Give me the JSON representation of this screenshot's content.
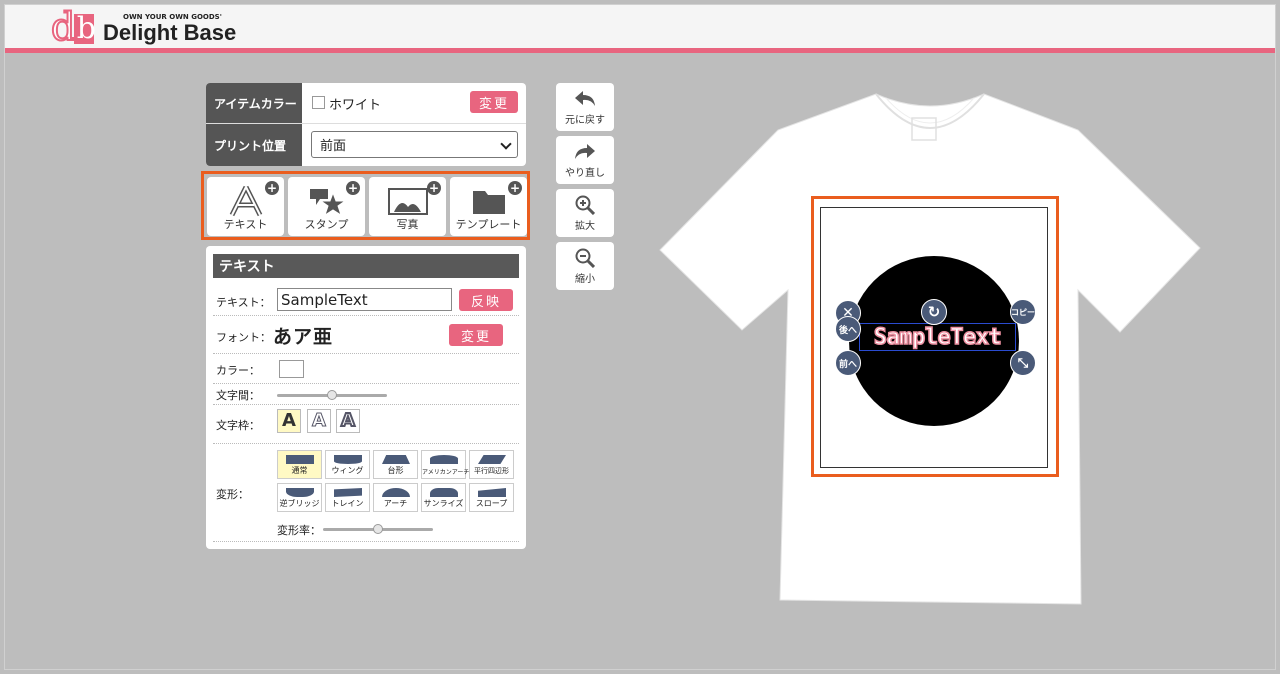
{
  "header": {
    "brand_tagline": "OWN YOUR OWN GOODS'",
    "brand_name": "Delight Base",
    "logo_mark": "db"
  },
  "options": {
    "item_color_label": "アイテムカラー",
    "item_color_value": "ホワイト",
    "item_color_change": "変更",
    "print_position_label": "プリント位置",
    "print_position_value": "前面"
  },
  "tools": [
    {
      "label": "テキスト",
      "icon": "text-a-icon"
    },
    {
      "label": "スタンプ",
      "icon": "stamp-star-icon"
    },
    {
      "label": "写真",
      "icon": "photo-icon"
    },
    {
      "label": "テンプレート",
      "icon": "folder-icon"
    }
  ],
  "side": {
    "undo": "元に戻す",
    "redo": "やり直し",
    "zoom_in": "拡大",
    "zoom_out": "縮小"
  },
  "text_panel": {
    "title": "テキスト",
    "text_label": "テキスト：",
    "text_value": "SampleText",
    "apply": "反映",
    "font_label": "フォント：",
    "font_sample": "あア亜",
    "font_change": "変更",
    "color_label": "カラー：",
    "spacing_label": "文字間：",
    "spacing_value": 0.5,
    "frame_label": "文字枠：",
    "frame_glyph": "A",
    "warp_label": "変形：",
    "warp_rate_label": "変形率：",
    "warp_rate_value": 0.5,
    "warps": [
      "通常",
      "ウィング",
      "台形",
      "アメリカンアーチ",
      "平行四辺形",
      "逆ブリッジ",
      "トレイン",
      "アーチ",
      "サンライズ",
      "スロープ"
    ]
  },
  "canvas": {
    "sample_text": "SampleText",
    "handles": {
      "back": "後へ",
      "front": "前へ",
      "copy": "コピー"
    }
  },
  "colors": {
    "brand_pink": "#e8657f",
    "highlight_orange": "#ea5d1e",
    "handle_navy": "#4a5a78"
  }
}
